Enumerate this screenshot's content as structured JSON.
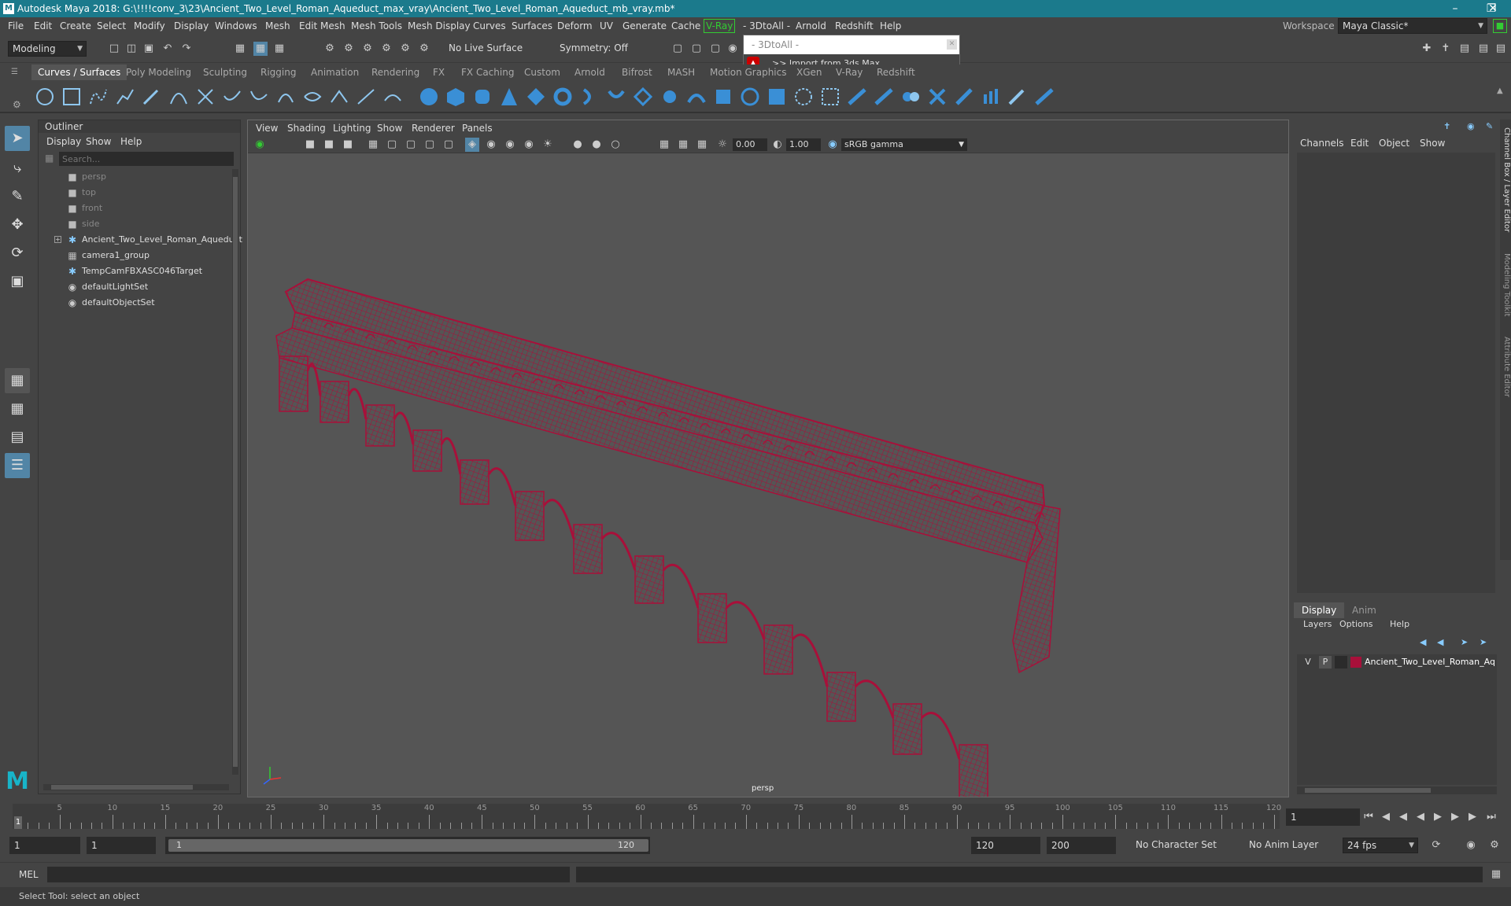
{
  "title": "Autodesk Maya 2018: G:\\!!!!conv_3\\23\\Ancient_Two_Level_Roman_Aqueduct_max_vray\\Ancient_Two_Level_Roman_Aqueduct_mb_vray.mb*",
  "menus": [
    "File",
    "Edit",
    "Create",
    "Select",
    "Modify",
    "Display",
    "Windows",
    "Mesh",
    "Edit Mesh",
    "Mesh Tools",
    "Mesh Display",
    "Curves",
    "Surfaces",
    "Deform",
    "UV",
    "Generate",
    "Cache",
    "V-Ray",
    "- 3DtoAll -",
    "Arnold",
    "Redshift",
    "Help"
  ],
  "workspace": {
    "label": "Workspace :",
    "value": "Maya Classic*"
  },
  "statusline": {
    "mode": "Modeling",
    "live_surface": "No Live Surface",
    "symmetry": "Symmetry: Off"
  },
  "popup": {
    "title": "- 3DtoAll -",
    "item": ">> Import from 3ds Max"
  },
  "shelf_tabs": [
    "Curves / Surfaces",
    "Poly Modeling",
    "Sculpting",
    "Rigging",
    "Animation",
    "Rendering",
    "FX",
    "FX Caching",
    "Custom",
    "Arnold",
    "Bifrost",
    "MASH",
    "Motion Graphics",
    "XGen",
    "V-Ray",
    "Redshift"
  ],
  "outliner": {
    "title": "Outliner",
    "menu": [
      "Display",
      "Show",
      "Help"
    ],
    "search_placeholder": "Search...",
    "items": [
      {
        "label": "persp",
        "dim": true
      },
      {
        "label": "top",
        "dim": true
      },
      {
        "label": "front",
        "dim": true
      },
      {
        "label": "side",
        "dim": true
      },
      {
        "label": "Ancient_Two_Level_Roman_Aqueduct",
        "dim": false
      },
      {
        "label": "camera1_group",
        "dim": false
      },
      {
        "label": "TempCamFBXASC046Target",
        "dim": false
      },
      {
        "label": "defaultLightSet",
        "dim": false
      },
      {
        "label": "defaultObjectSet",
        "dim": false
      }
    ]
  },
  "viewport": {
    "menu": [
      "View",
      "Shading",
      "Lighting",
      "Show",
      "Renderer",
      "Panels"
    ],
    "exposure": "0.00",
    "gamma": "1.00",
    "colorspace": "sRGB gamma",
    "camera": "persp",
    "wire_color": "#a8103a"
  },
  "channelbox": {
    "menu": [
      "Channels",
      "Edit",
      "Object",
      "Show"
    ]
  },
  "layers": {
    "tabs": [
      "Display",
      "Anim"
    ],
    "menu": [
      "Layers",
      "Options",
      "Help"
    ],
    "row": {
      "v": "V",
      "p": "P",
      "name": "Ancient_Two_Level_Roman_Aq",
      "color": "#a8103a"
    }
  },
  "side_tabs": [
    "Channel Box / Layer Editor",
    "Modeling Toolkit",
    "Attribute Editor"
  ],
  "timeline": {
    "ticks": [
      "5",
      "10",
      "15",
      "20",
      "25",
      "30",
      "35",
      "40",
      "45",
      "50",
      "55",
      "60",
      "65",
      "70",
      "75",
      "80",
      "85",
      "90",
      "95",
      "100",
      "105",
      "110",
      "115",
      "120"
    ],
    "start_marker": "1",
    "current_frame": "1"
  },
  "range": {
    "start": "1",
    "playback_start": "1",
    "slider_start": "1",
    "slider_end": "120",
    "playback_end": "120",
    "end": "200",
    "character_set": "No Character Set",
    "anim_layer": "No Anim Layer",
    "fps": "24 fps"
  },
  "cmdline": {
    "label": "MEL"
  },
  "helpline": "Select Tool: select an object"
}
